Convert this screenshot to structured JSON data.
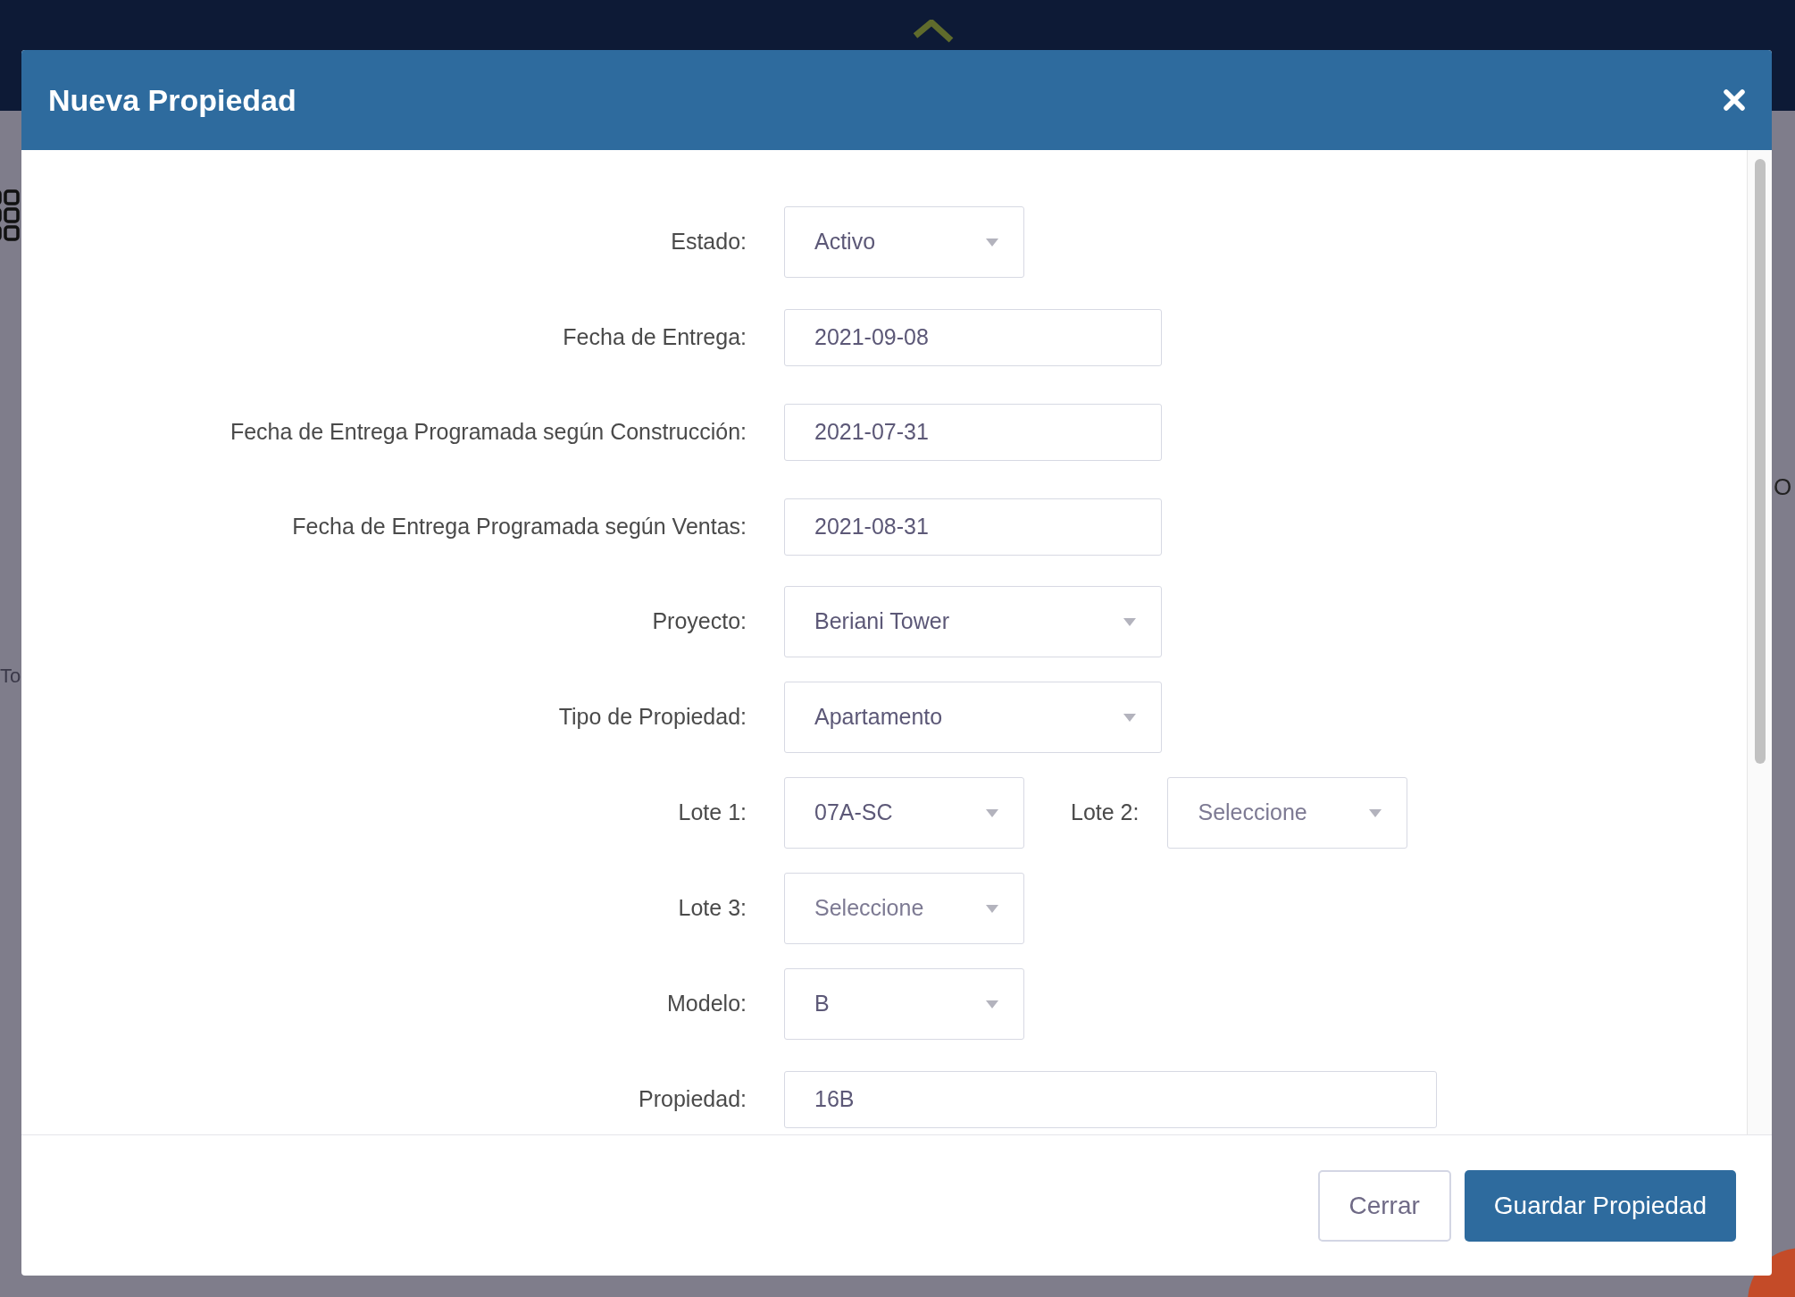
{
  "background": {
    "left_text": "To",
    "right_text": "O"
  },
  "dialog": {
    "title": "Nueva Propiedad",
    "rows": [
      {
        "fields": [
          {
            "label": "Estado:",
            "kind": "select",
            "value": "Activo"
          }
        ]
      },
      {
        "fields": [
          {
            "label": "Fecha de Entrega:",
            "kind": "date",
            "value": "2021-09-08"
          }
        ]
      },
      {
        "fields": [
          {
            "label": "Fecha de Entrega Programada según Construcción:",
            "kind": "date",
            "value": "2021-07-31"
          }
        ]
      },
      {
        "fields": [
          {
            "label": "Fecha de Entrega Programada según Ventas:",
            "kind": "date",
            "value": "2021-08-31"
          }
        ]
      },
      {
        "fields": [
          {
            "label": "Proyecto:",
            "kind": "listbox",
            "value": "Beriani Tower"
          }
        ]
      },
      {
        "fields": [
          {
            "label": "Tipo de Propiedad:",
            "kind": "listbox",
            "value": "Apartamento"
          }
        ]
      },
      {
        "fields": [
          {
            "label": "Lote 1:",
            "kind": "select",
            "value": "07A-SC"
          },
          {
            "label": "Lote 2:",
            "kind": "select",
            "placeholder": "Seleccione"
          }
        ]
      },
      {
        "fields": [
          {
            "label": "Lote 3:",
            "kind": "select",
            "placeholder": "Seleccione"
          }
        ]
      },
      {
        "fields": [
          {
            "label": "Modelo:",
            "kind": "select",
            "value": "B"
          }
        ]
      },
      {
        "fields": [
          {
            "label": "Propiedad:",
            "kind": "text",
            "value": "16B"
          }
        ]
      }
    ],
    "buttons": [
      {
        "label": "Cerrar",
        "kind": "secondary"
      },
      {
        "label": "Guardar Propiedad",
        "kind": "primary"
      }
    ]
  }
}
